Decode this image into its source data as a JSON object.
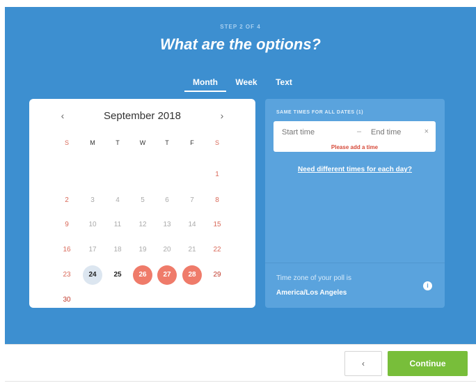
{
  "header": {
    "step": "STEP 2 OF 4",
    "title": "What are the options?"
  },
  "tabs": [
    {
      "label": "Month",
      "active": true
    },
    {
      "label": "Week",
      "active": false
    },
    {
      "label": "Text",
      "active": false
    }
  ],
  "calendar": {
    "month_label": "September 2018",
    "prev_icon": "‹",
    "next_icon": "›",
    "weekdays": [
      "S",
      "M",
      "T",
      "W",
      "T",
      "F",
      "S"
    ],
    "days": [
      "1",
      "2",
      "3",
      "4",
      "5",
      "6",
      "7",
      "8",
      "9",
      "10",
      "11",
      "12",
      "13",
      "14",
      "15",
      "16",
      "17",
      "18",
      "19",
      "20",
      "21",
      "22",
      "23",
      "24",
      "25",
      "26",
      "27",
      "28",
      "29",
      "30"
    ],
    "today": 24,
    "selected": [
      26,
      27,
      28
    ]
  },
  "times": {
    "heading": "SAME TIMES FOR ALL DATES (1)",
    "start_placeholder": "Start time",
    "dash": "–",
    "end_placeholder": "End time",
    "clear_icon": "×",
    "error": "Please add a time",
    "diff_link": "Need different times for each day?",
    "tz_label": "Time zone of your poll is",
    "tz_value": "America/Los Angeles",
    "tz_info_icon": "i"
  },
  "footer": {
    "back_label": "‹",
    "continue_label": "Continue"
  },
  "colors": {
    "panel": "#3d8fd0",
    "times_panel": "#5aa3dd",
    "selected_day": "#ef7b6a",
    "continue": "#78be3a",
    "error": "#d64a3a"
  }
}
